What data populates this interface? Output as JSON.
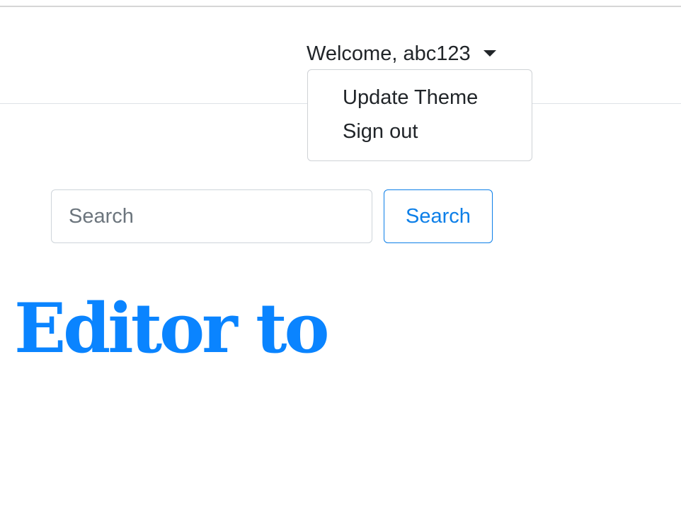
{
  "header": {
    "user_menu": {
      "welcome_text": "Welcome, abc123",
      "items": [
        {
          "label": "Update Theme"
        },
        {
          "label": "Sign out"
        }
      ]
    }
  },
  "search": {
    "placeholder": "Search",
    "value": "",
    "button_label": "Search"
  },
  "main": {
    "heading": "Editor to"
  },
  "colors": {
    "accent": "#0a84ff",
    "text": "#212529",
    "border": "#ced4da"
  }
}
